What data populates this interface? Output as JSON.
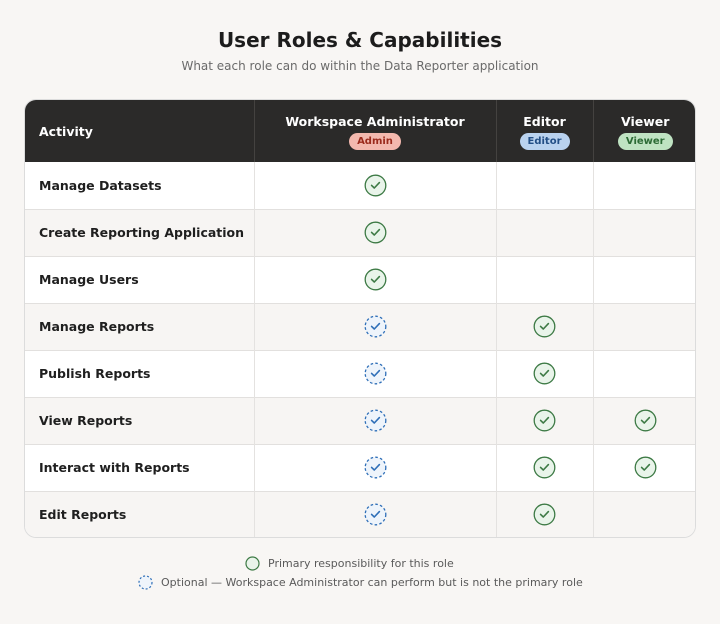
{
  "header": {
    "title": "User Roles & Capabilities",
    "subtitle": "What each role can do within the Data Reporter application"
  },
  "table": {
    "activity_header": "Activity",
    "roles": [
      {
        "name": "Workspace Administrator",
        "badge": "Admin",
        "badge_color": "#f3b8ae"
      },
      {
        "name": "Editor",
        "badge": "Editor",
        "badge_color": "#b9d2ef"
      },
      {
        "name": "Viewer",
        "badge": "Viewer",
        "badge_color": "#bfe3c2"
      }
    ],
    "rows": [
      {
        "activity": "Manage Datasets",
        "marks": [
          "primary",
          "none",
          "none"
        ]
      },
      {
        "activity": "Create Reporting Application",
        "marks": [
          "primary",
          "none",
          "none"
        ]
      },
      {
        "activity": "Manage Users",
        "marks": [
          "primary",
          "none",
          "none"
        ]
      },
      {
        "activity": "Manage Reports",
        "marks": [
          "optional",
          "primary",
          "none"
        ]
      },
      {
        "activity": "Publish Reports",
        "marks": [
          "optional",
          "primary",
          "none"
        ]
      },
      {
        "activity": "View Reports",
        "marks": [
          "optional",
          "primary",
          "primary"
        ]
      },
      {
        "activity": "Interact with Reports",
        "marks": [
          "optional",
          "primary",
          "primary"
        ]
      },
      {
        "activity": "Edit Reports",
        "marks": [
          "optional",
          "primary",
          "none"
        ]
      }
    ]
  },
  "legend": {
    "primary": "Primary responsibility for this role",
    "optional": "Optional — Workspace Administrator can perform but is not the primary role"
  },
  "colors": {
    "primary_check": "#3d7a45",
    "optional_check": "#2f6fb8",
    "header_bg": "#2b2a29"
  }
}
